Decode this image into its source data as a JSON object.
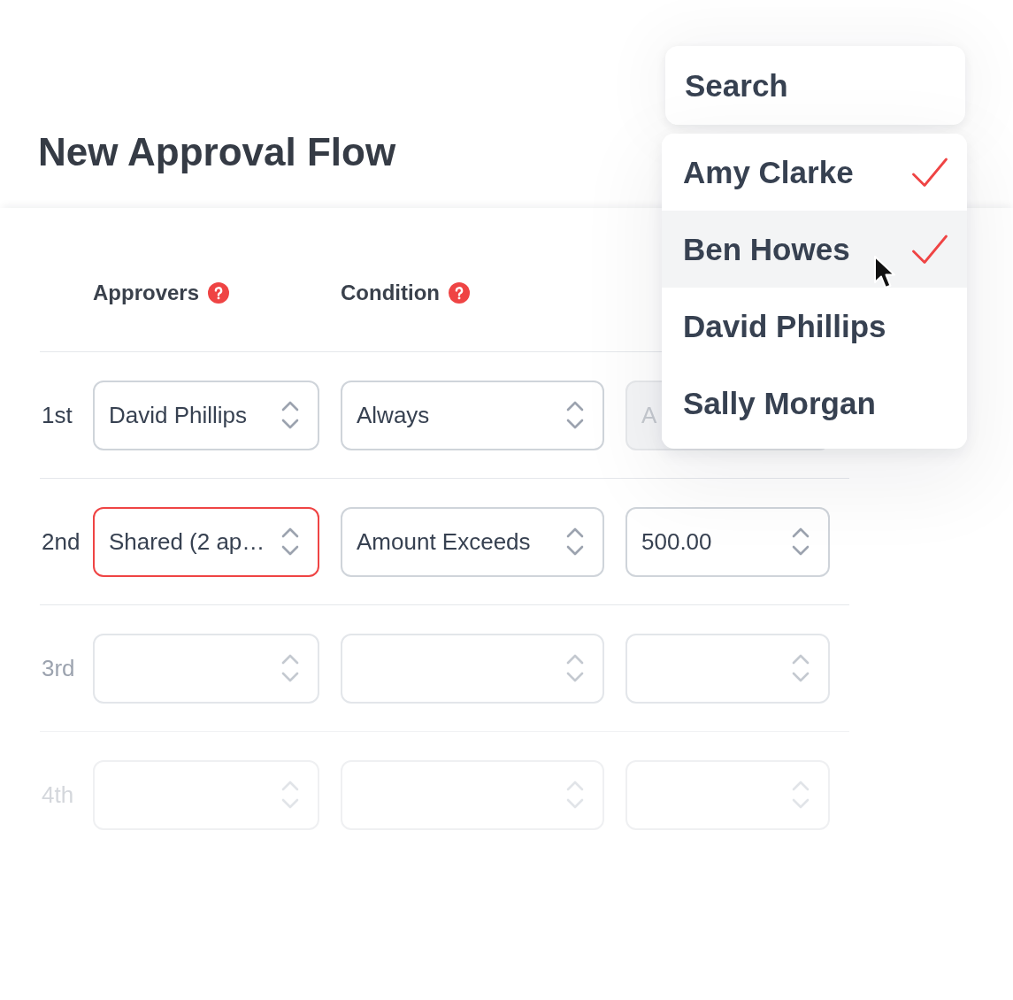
{
  "title": "New Approval Flow",
  "table": {
    "columns": [
      {
        "label": "Approvers",
        "help": true
      },
      {
        "label": "Condition",
        "help": true
      }
    ],
    "rows": [
      {
        "label": "1st",
        "kind": "active",
        "fields": [
          {
            "value": "David Phillips",
            "invalid": false,
            "disabled": false
          },
          {
            "value": "Always",
            "invalid": false,
            "disabled": false
          },
          {
            "value": "A",
            "invalid": false,
            "disabled": true
          }
        ]
      },
      {
        "label": "2nd",
        "kind": "active",
        "fields": [
          {
            "value": "Shared (2 ap…",
            "invalid": true,
            "disabled": false
          },
          {
            "value": "Amount Exceeds",
            "invalid": false,
            "disabled": false
          },
          {
            "value": "500.00",
            "invalid": false,
            "disabled": false
          }
        ]
      },
      {
        "label": "3rd",
        "kind": "upcoming",
        "fields": [
          {
            "invalid": false,
            "disabled": false
          },
          {
            "invalid": false,
            "disabled": false
          },
          {
            "invalid": false,
            "disabled": false
          }
        ]
      },
      {
        "label": "4th",
        "kind": "ghost",
        "fields": [
          {
            "invalid": false,
            "disabled": false
          },
          {
            "invalid": false,
            "disabled": false
          },
          {
            "invalid": false,
            "disabled": false
          }
        ]
      }
    ]
  },
  "approver_picker": {
    "search": {
      "placeholder": "Search"
    },
    "options": [
      {
        "name": "Amy Clarke",
        "selected": true,
        "hovered": false
      },
      {
        "name": "Ben Howes",
        "selected": true,
        "hovered": true
      },
      {
        "name": "David Phillips",
        "selected": false,
        "hovered": false
      },
      {
        "name": "Sally Morgan",
        "selected": false,
        "hovered": false
      }
    ]
  }
}
